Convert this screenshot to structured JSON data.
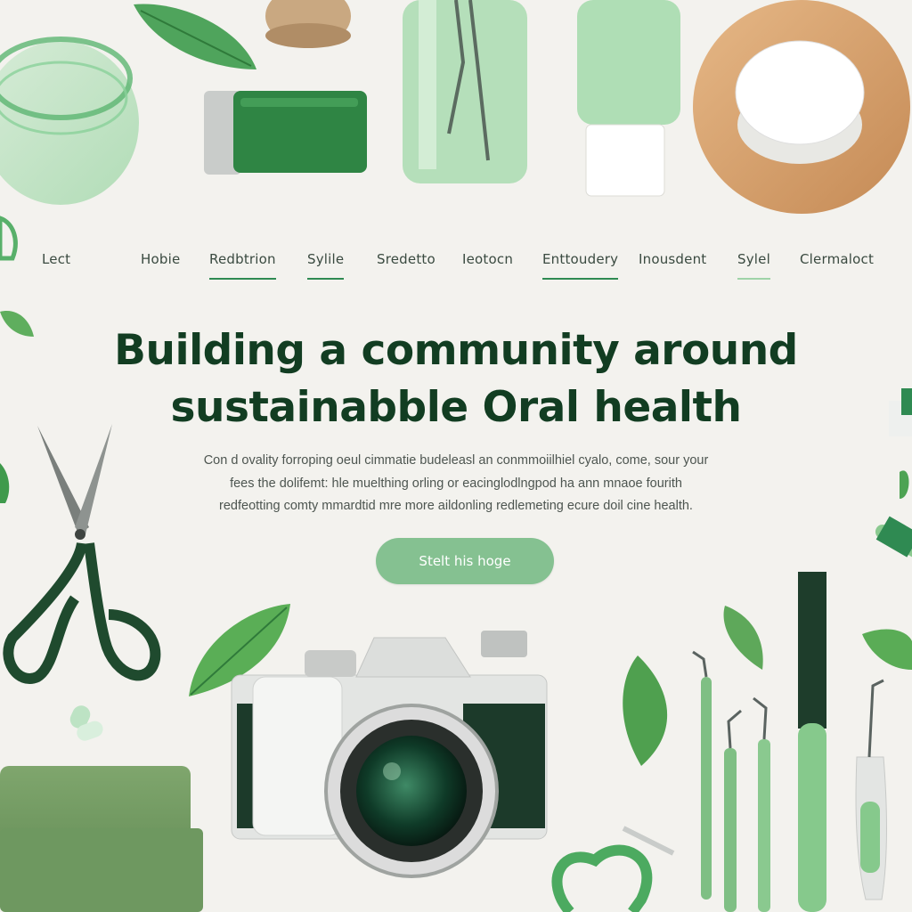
{
  "nav": {
    "items": [
      {
        "label": "Lect"
      },
      {
        "label": "Hobie"
      },
      {
        "label": "Redbtrion"
      },
      {
        "label": "Sylile"
      },
      {
        "label": "Sredetto"
      },
      {
        "label": "Ieotocn"
      },
      {
        "label": "Enttoudery"
      },
      {
        "label": "Inousdent"
      },
      {
        "label": "Sylel"
      },
      {
        "label": "Clermaloct"
      }
    ]
  },
  "hero": {
    "title_line1": "Building a community around",
    "title_line2": "sustainabble Oral health",
    "subtitle_line1": "Con d ovality forroping oeul cimmatie budeleasl an conmmoiilhiel cyalo, come, sour your",
    "subtitle_line2": "fees the dolifemt: hle muelthing orling or eacinglodlngpod ha ann mnaoe fourith",
    "subtitle_line3": "redfeotting comty mmardtid mre more aildonling redlemeting ecure doil cine health.",
    "cta_label": "Stelt his hoge"
  },
  "colors": {
    "background": "#f3f2ee",
    "title": "#123d22",
    "accent": "#2f8a52",
    "cta": "#85c191"
  },
  "icons": [
    "leaf-icon",
    "scissors-icon",
    "camera-icon",
    "toothbrush-icon",
    "dental-tool-icon",
    "glass-jar-icon",
    "bottle-icon",
    "cream-jar-icon",
    "twine-spool-icon",
    "cloth-pouch-icon",
    "heart-floss-icon"
  ]
}
